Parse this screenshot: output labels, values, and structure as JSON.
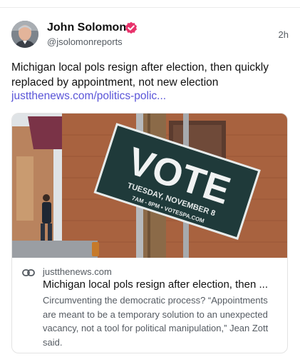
{
  "post": {
    "author": {
      "name": "John Solomon",
      "handle": "@jsolomonreports",
      "verified_color": "#e8326b"
    },
    "timestamp": "2h",
    "text": "Michigan local pols resign after election, then quickly replaced by appointment, not new election",
    "link_text": "justthenews.com/politics-polic...",
    "link_color": "#5a55d8",
    "link_card": {
      "domain": "justthenews.com",
      "title": "Michigan local pols resign after election, then ...",
      "description": "Circumventing the democratic process? “Appointments are meant to be a temporary solution to an unexpected vacancy, not a tool for political manipulation,” Jean Zott said.",
      "image": {
        "sign_text": "VOTE",
        "sign_subtext": "TUESDAY, NOVEMBER 8",
        "sign_small": "7AM - 8PM • VOTESPA.COM"
      }
    }
  }
}
